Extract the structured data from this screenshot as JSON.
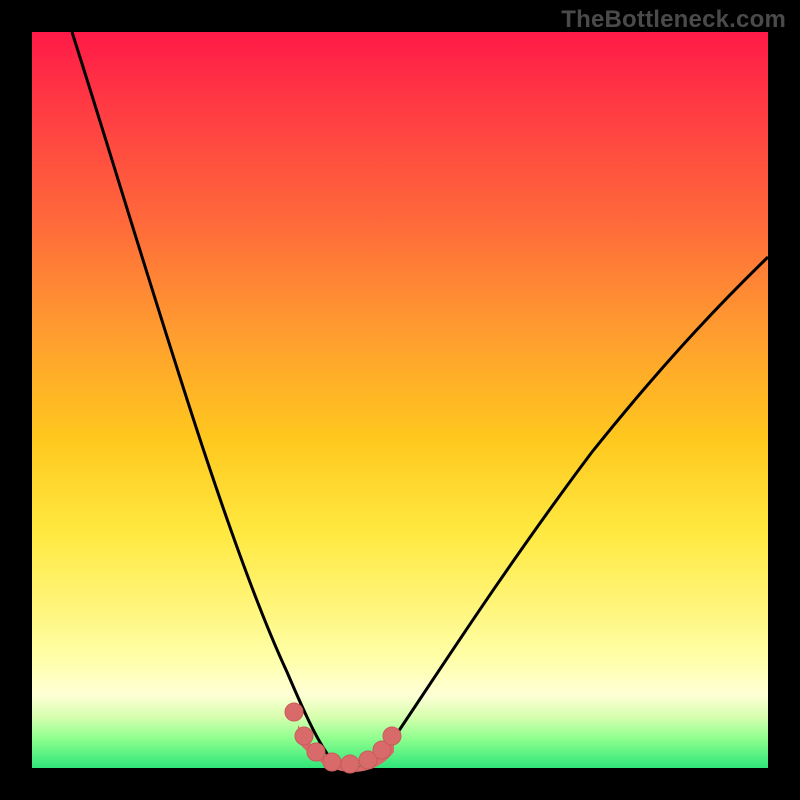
{
  "watermark": {
    "text": "TheBottleneck.com"
  },
  "colors": {
    "frame": "#000000",
    "curve_stroke": "#000000",
    "markers_fill": "#d86a6a",
    "markers_stroke": "#c95b5b"
  },
  "chart_data": {
    "type": "line",
    "title": "",
    "xlabel": "",
    "ylabel": "",
    "xlim": [
      0,
      100
    ],
    "ylim": [
      0,
      100
    ],
    "grid": false,
    "series": [
      {
        "name": "bottleneck-curve",
        "note": "V-shaped curve; percentages read off vertical position (0=top, 100=bottom). Minimum near x≈40.",
        "x": [
          0,
          4,
          8,
          12,
          16,
          20,
          24,
          28,
          32,
          35,
          37,
          39,
          40,
          42,
          44,
          46,
          50,
          55,
          60,
          65,
          70,
          75,
          80,
          85,
          90,
          95,
          100
        ],
        "y": [
          0,
          13,
          26,
          38,
          49,
          59,
          69,
          78,
          86,
          92,
          96,
          99,
          100,
          99,
          97,
          95,
          90,
          83,
          76,
          69,
          62,
          56,
          50,
          44,
          39,
          34,
          30
        ]
      }
    ],
    "markers": {
      "name": "highlighted-points",
      "note": "Salmon dots/segment near the curve floor.",
      "x": [
        35,
        36.5,
        38,
        40,
        42,
        44,
        45.5,
        46.5
      ],
      "y": [
        92,
        96,
        99,
        100,
        100,
        99,
        97.5,
        95.5
      ]
    }
  }
}
